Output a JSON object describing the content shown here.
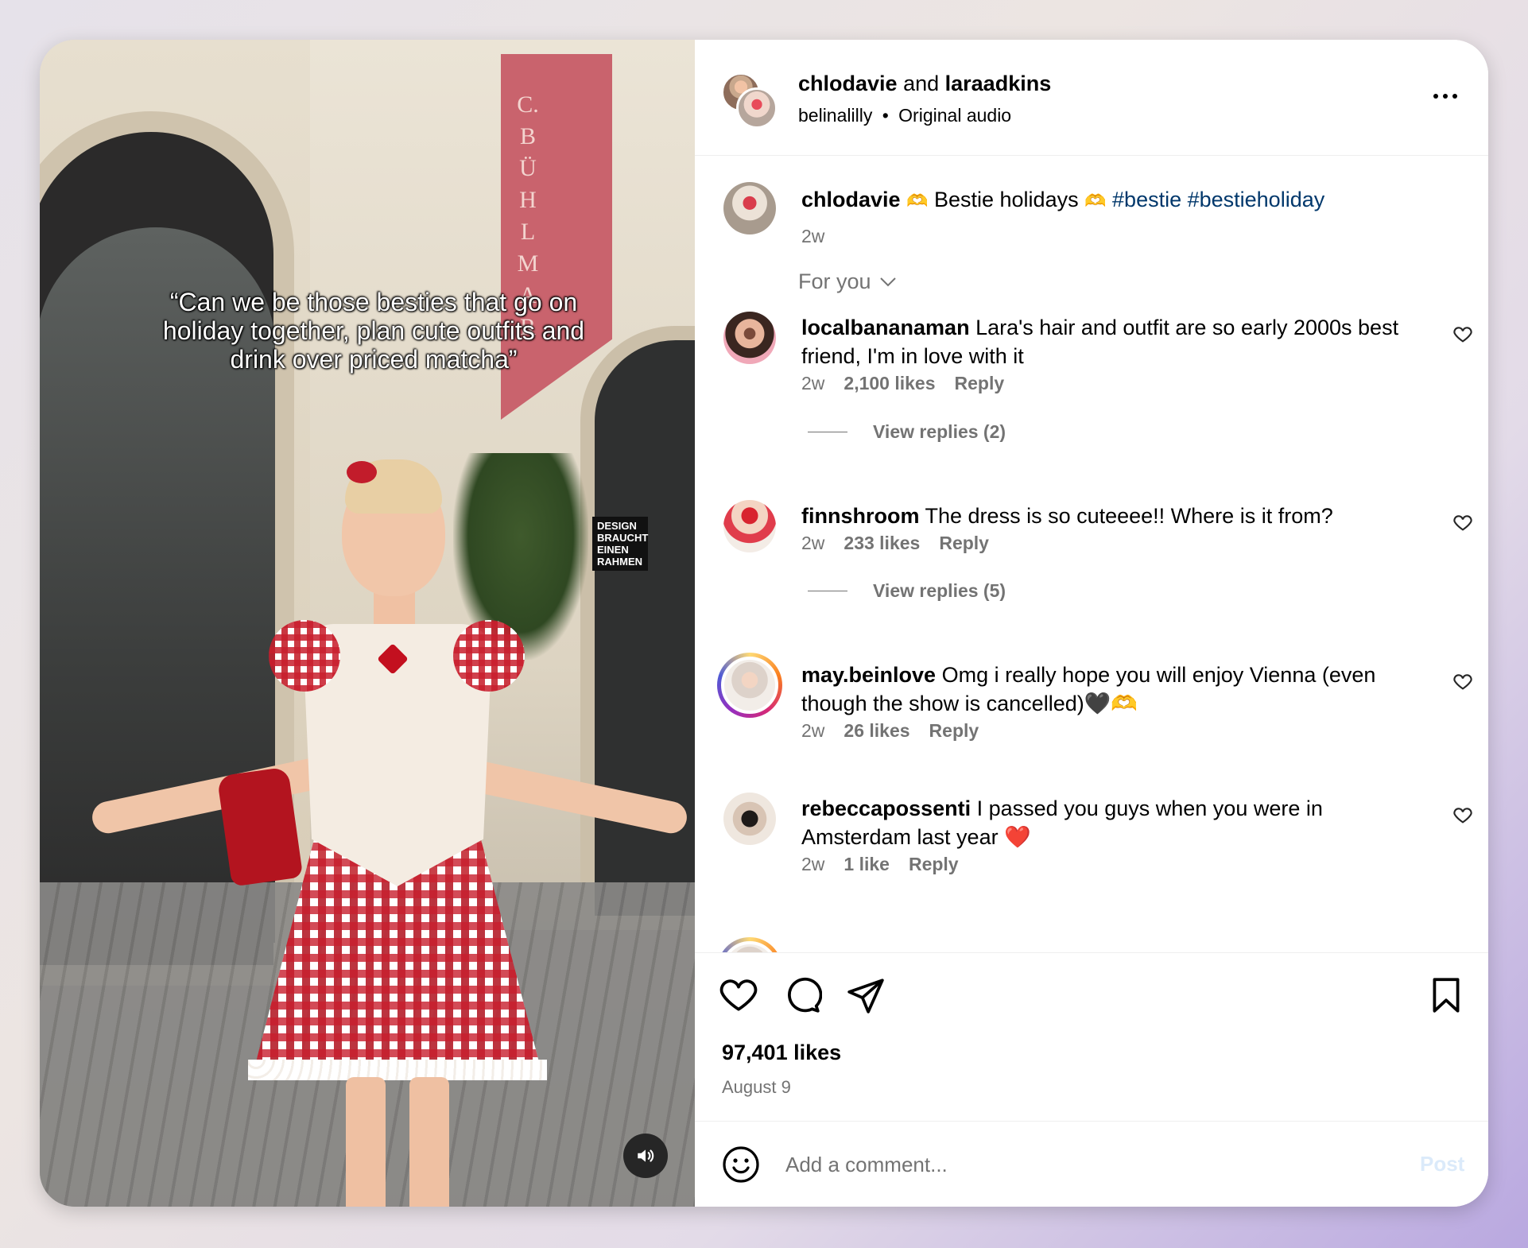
{
  "media": {
    "overlay_text": "“Can we be those besties that go on holiday together, plan cute outfits and drink over priced matcha”",
    "banner_letters": [
      "C.",
      "B",
      "Ü",
      "H",
      "L",
      "M",
      "A",
      "R"
    ],
    "sign_text": "DESIGN BRAUCHT EINEN RAHMEN"
  },
  "header": {
    "user1": "chlodavie",
    "and": "and",
    "user2": "laraadkins",
    "sub_user": "belinalilly",
    "separator": "•",
    "audio": "Original audio"
  },
  "caption": {
    "user": "chlodavie",
    "emoji": "🫶",
    "text": "Bestie holidays",
    "tags": "#bestie #bestieholiday",
    "time": "2w"
  },
  "filter": {
    "label": "For you"
  },
  "comments": [
    {
      "user": "localbananaman",
      "text": "Lara's hair and outfit are so early 2000s best friend, I'm in love with it",
      "time": "2w",
      "likes": "2,100 likes",
      "reply": "Reply",
      "view_replies": "View replies (2)"
    },
    {
      "user": "finnshroom",
      "text": "The dress is so cuteeee!! Where is it from?",
      "time": "2w",
      "likes": "233 likes",
      "reply": "Reply",
      "view_replies": "View replies (5)"
    },
    {
      "user": "may.beinlove",
      "text": "Omg i really hope you will enjoy Vienna (even though the show is cancelled)🖤🫶",
      "time": "2w",
      "likes": "26 likes",
      "reply": "Reply"
    },
    {
      "user": "rebeccapossenti",
      "text": "I passed you guys when you were in Amsterdam last year ❤️",
      "time": "2w",
      "likes": "1 like",
      "reply": "Reply"
    }
  ],
  "post": {
    "likes": "97,401 likes",
    "date": "August 9"
  },
  "composer": {
    "placeholder": "Add a comment...",
    "post_label": "Post"
  }
}
